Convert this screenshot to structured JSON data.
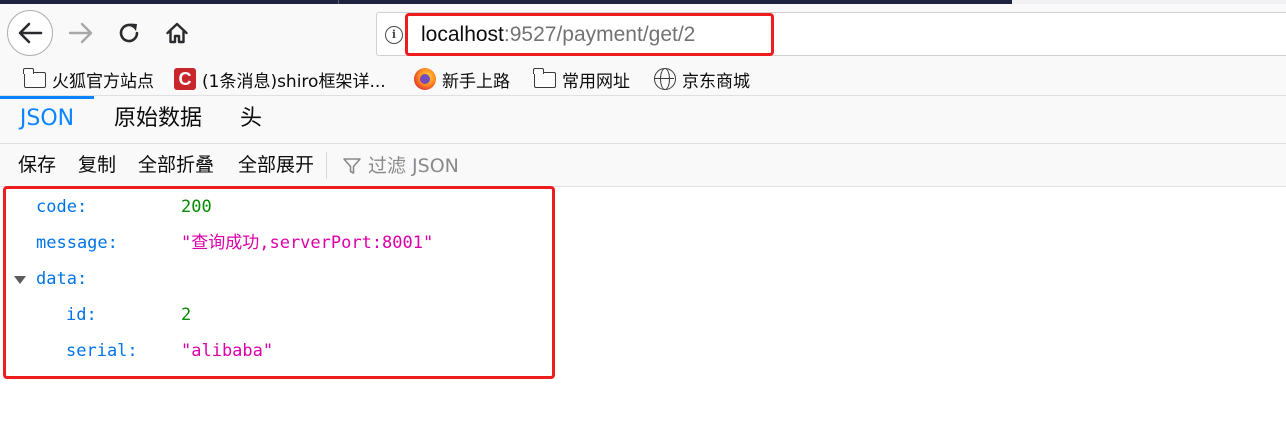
{
  "address_bar": {
    "url_host": "localhost",
    "url_rest": ":9527/payment/get/2"
  },
  "bookmarks": [
    {
      "label": "火狐官方站点",
      "icon": "folder-icon"
    },
    {
      "label": "(1条消息)shiro框架详...",
      "icon": "csdn-icon",
      "icon_text": "C"
    },
    {
      "label": "新手上路",
      "icon": "firefox-icon"
    },
    {
      "label": "常用网址",
      "icon": "folder-icon"
    },
    {
      "label": "京东商城",
      "icon": "globe-icon"
    }
  ],
  "viewer_tabs": [
    {
      "label": "JSON",
      "active": true
    },
    {
      "label": "原始数据",
      "active": false
    },
    {
      "label": "头",
      "active": false
    }
  ],
  "json_toolbar": {
    "save": "保存",
    "copy": "复制",
    "collapse_all": "全部折叠",
    "expand_all": "全部展开",
    "filter_placeholder": "过滤 JSON"
  },
  "json": {
    "code_key": "code:",
    "code_value": "200",
    "message_key": "message:",
    "message_value": "\"查询成功,serverPort:8001\"",
    "data_key": "data:",
    "id_key": "id:",
    "id_value": "2",
    "serial_key": "serial:",
    "serial_value": "\"alibaba\""
  },
  "colors": {
    "accent": "#0a84ff",
    "json_key": "#0074e8",
    "json_number": "#058b00",
    "json_string": "#dd00a9",
    "highlight": "#ee1c1c"
  }
}
